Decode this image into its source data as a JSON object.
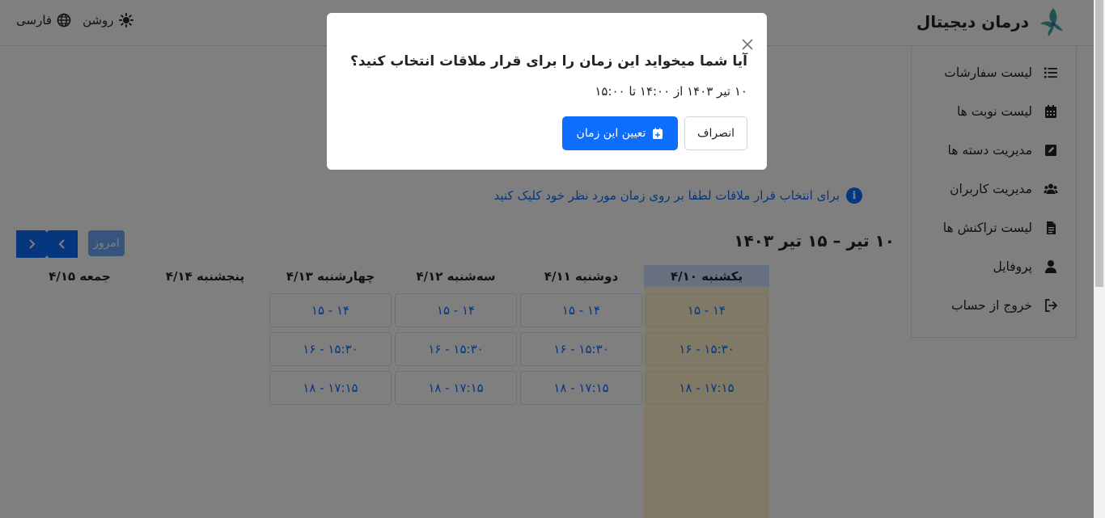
{
  "header": {
    "brand_title": "درمان دیجیتال",
    "theme_label": "روشن",
    "language_label": "فارسی"
  },
  "sidebar": {
    "items": [
      {
        "label": "لیست سفارشات",
        "icon": "list-icon"
      },
      {
        "label": "لیست نوبت ها",
        "icon": "calendar-icon"
      },
      {
        "label": "مدیریت دسته ها",
        "icon": "edit-square-icon"
      },
      {
        "label": "مدیریت کاربران",
        "icon": "users-icon"
      },
      {
        "label": "لیست تراکنش ها",
        "icon": "document-icon"
      },
      {
        "label": "پروفایل",
        "icon": "user-icon"
      },
      {
        "label": "خروج از حساب",
        "icon": "logout-icon"
      }
    ]
  },
  "main": {
    "info_text": "برای انتخاب قرار ملاقات لطفا بر روی زمان مورد نظر خود کلیک کنید",
    "range_title": "۱۰ تیر – ۱۵ تیر ۱۴۰۳",
    "today_label": "امروز"
  },
  "calendar": {
    "days": [
      {
        "label": "یکشنبه ۴/۱۰",
        "today": true,
        "slots": [
          "۱۴ - ۱۵",
          "۱۵:۳۰ - ۱۶",
          "۱۷:۱۵ - ۱۸"
        ]
      },
      {
        "label": "دوشنبه ۴/۱۱",
        "today": false,
        "slots": [
          "۱۴ - ۱۵",
          "۱۵:۳۰ - ۱۶",
          "۱۷:۱۵ - ۱۸"
        ]
      },
      {
        "label": "سه‌شنبه ۴/۱۲",
        "today": false,
        "slots": [
          "۱۴ - ۱۵",
          "۱۵:۳۰ - ۱۶",
          "۱۷:۱۵ - ۱۸"
        ]
      },
      {
        "label": "چهارشنبه ۴/۱۳",
        "today": false,
        "slots": [
          "۱۴ - ۱۵",
          "۱۵:۳۰ - ۱۶",
          "۱۷:۱۵ - ۱۸"
        ]
      },
      {
        "label": "پنجشنبه ۴/۱۴",
        "today": false,
        "slots": []
      },
      {
        "label": "جمعه ۴/۱۵",
        "today": false,
        "slots": []
      }
    ]
  },
  "modal": {
    "title": "آیا شما میخواید این زمان را برای قرار ملاقات انتخاب کنید؟",
    "text": "۱۰ تیر ۱۴۰۳ از ۱۴:۰۰ تا ۱۵:۰۰",
    "cancel_label": "انصراف",
    "confirm_label": "تعیین این زمان"
  },
  "colors": {
    "primary": "#0d6efd",
    "today_bg": "#fff3cd",
    "today_head_bg": "#cfe2ff"
  }
}
